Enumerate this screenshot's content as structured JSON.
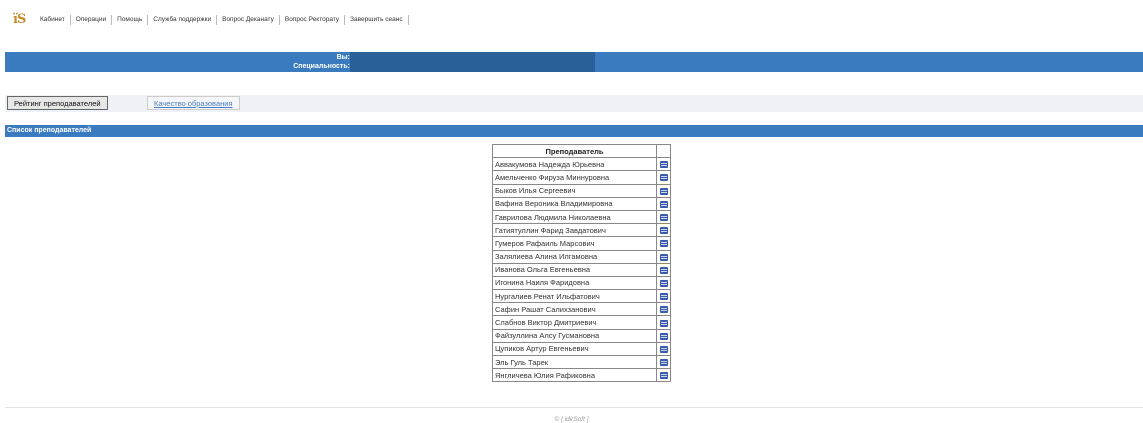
{
  "header": {
    "logo_text": "ïS",
    "menu": [
      "Кабинет",
      "Операции",
      "Помощь",
      "Служба поддержки",
      "Вопрос Деканату",
      "Вопрос Ректорату",
      "Завершить сеанс"
    ]
  },
  "userbar": {
    "you_label": "Вы:",
    "specialty_label": "Специальность:"
  },
  "tabs": {
    "active": "Рейтинг преподавателей",
    "link": "Качество образования"
  },
  "section": {
    "title": "Список преподавателей"
  },
  "table": {
    "header": "Преподаватель",
    "rows": [
      "Аввакумова Надежда Юрьевна",
      "Амельченко Фируза Миннуровна",
      "Быков Илья Сергеевич",
      "Вафина Вероника Владимировна",
      "Гаврилова Людмила Николаевна",
      "Гатиятуллин Фарид Завдатович",
      "Гумеров Рафаиль Марсович",
      "Залялиева Алина Илгамовна",
      "Иванова Ольга Евгеньевна",
      "Игонина Наиля Фаридовна",
      "Нургалиев Ренат Ильфатович",
      "Сафин Рашат Салихзанович",
      "Слабнов Виктор Дмитриевич",
      "Файзуллина Алсу Гусмановна",
      "Цупиков Артур Евгеньевич",
      "Эль Гуль Тарек",
      "Янгличева Юлия Рафиковна"
    ],
    "row_icon": "rate-icon"
  },
  "footer": {
    "text": "© [ idirSoft ]"
  },
  "colors": {
    "bar": "#3a7bbf",
    "masked": "#2b5f98",
    "link": "#4a7dc0"
  }
}
